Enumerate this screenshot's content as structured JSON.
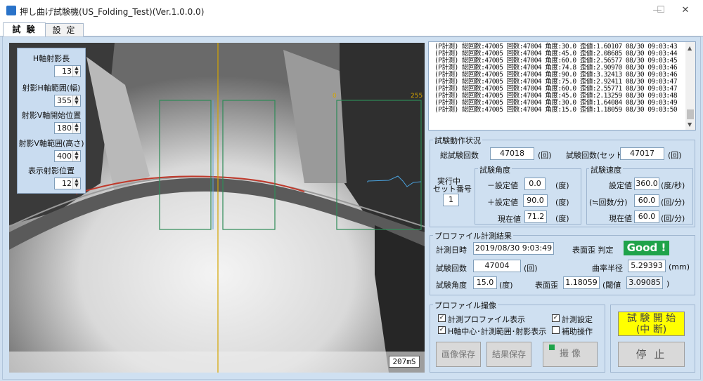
{
  "window": {
    "title": "押し曲げ試験機(US_Folding_Test)(Ver.1.0.0.0)",
    "min": "—",
    "max": "☐",
    "close": "✕",
    "app_icon": "app-icon"
  },
  "tabs": [
    {
      "label": "試 験"
    },
    {
      "label": "設 定"
    }
  ],
  "camera": {
    "timing": "207mS",
    "scale_min": "0",
    "scale_max": "255"
  },
  "overlay": {
    "h_axis_length_label": "H軸射影長",
    "h_axis_length": "13",
    "h_range_label": "射影H軸範囲(幅)",
    "h_range": "355",
    "v_start_label": "射影V軸開始位置",
    "v_start": "180",
    "v_range_label": "射影V軸範囲(高さ)",
    "v_range": "400",
    "display_pos_label": "表示射影位置",
    "display_pos": "12"
  },
  "log": [
    "(P計測) 総回数:47005 回数:47004 角度:30.0 歪値:1.60107   08/30 09:03:43",
    "(P計測) 総回数:47005 回数:47004 角度:45.0 歪値:2.08685   08/30 09:03:44",
    "(P計測) 総回数:47005 回数:47004 角度:60.0 歪値:2.56577   08/30 09:03:45",
    "(P計測) 総回数:47005 回数:47004 角度:74.8 歪値:2.90970   08/30 09:03:46",
    "(P計測) 総回数:47005 回数:47004 角度:90.0 歪値:3.32413   08/30 09:03:46",
    "(P計測) 総回数:47005 回数:47004 角度:75.0 歪値:2.92411   08/30 09:03:47",
    "(P計測) 総回数:47005 回数:47004 角度:60.0 歪値:2.55771   08/30 09:03:47",
    "(P計測) 総回数:47005 回数:47004 角度:45.0 歪値:2.13259   08/30 09:03:48",
    "(P計測) 総回数:47005 回数:47004 角度:30.0 歪値:1.64084   08/30 09:03:49",
    "(P計測) 総回数:47005 回数:47004 角度:15.0 歪値:1.18059   08/30 09:03:50"
  ],
  "status": {
    "legend": "試験動作状況",
    "total_count_label": "総試験回数",
    "total_count": "47018",
    "unit_times": "(回)",
    "set_count_label": "試験回数(セット)",
    "set_count": "47017",
    "exec_set_label_1": "実行中",
    "exec_set_label_2": "セット番号",
    "exec_set": "1",
    "angle_legend": "試験角度",
    "minus_label": "－設定値",
    "minus_val": "0.0",
    "deg": "(度)",
    "plus_label": "＋設定値",
    "plus_val": "90.0",
    "current_label": "現在値",
    "current_angle": "71.2",
    "speed_legend": "試験速度",
    "speed_set_label": "設定値",
    "speed_set": "360.0",
    "speed_unit": "(度/秒)",
    "speed_approx_label": "(≒回数/分)",
    "speed_approx": "60.0",
    "per_min": "(回/分)",
    "speed_current_label": "現在値",
    "speed_current": "60.0"
  },
  "profile": {
    "legend": "プロファイル計測結果",
    "datetime_label": "計測日時",
    "datetime": "2019/08/30 9:03:49",
    "judge_label": "表面歪 判定",
    "judge": "Good !",
    "count_label": "試験回数",
    "count": "47004",
    "count_unit": "(回)",
    "radius_label": "曲率半径",
    "radius": "5.29393",
    "radius_unit": "(mm)",
    "angle_label": "試験角度",
    "angle": "15.0",
    "angle_unit": "(度)",
    "strain_label": "表面歪",
    "strain": "1.18059",
    "threshold_label": "(閾値",
    "threshold": "3.09085",
    "threshold_close": ")"
  },
  "capture": {
    "legend": "プロファイル撮像",
    "chk1": "計測プロファイル表示",
    "chk2": "計測設定",
    "chk3": "H軸中心･計測範囲･射影表示",
    "chk4": "補助操作",
    "save_image": "画像保存",
    "save_result": "結果保存",
    "shoot": "撮 像"
  },
  "control": {
    "start": "試 験 開 始",
    "start_sub": "(中 断)",
    "stop": "停 止",
    "start_color": "#ffff00"
  }
}
